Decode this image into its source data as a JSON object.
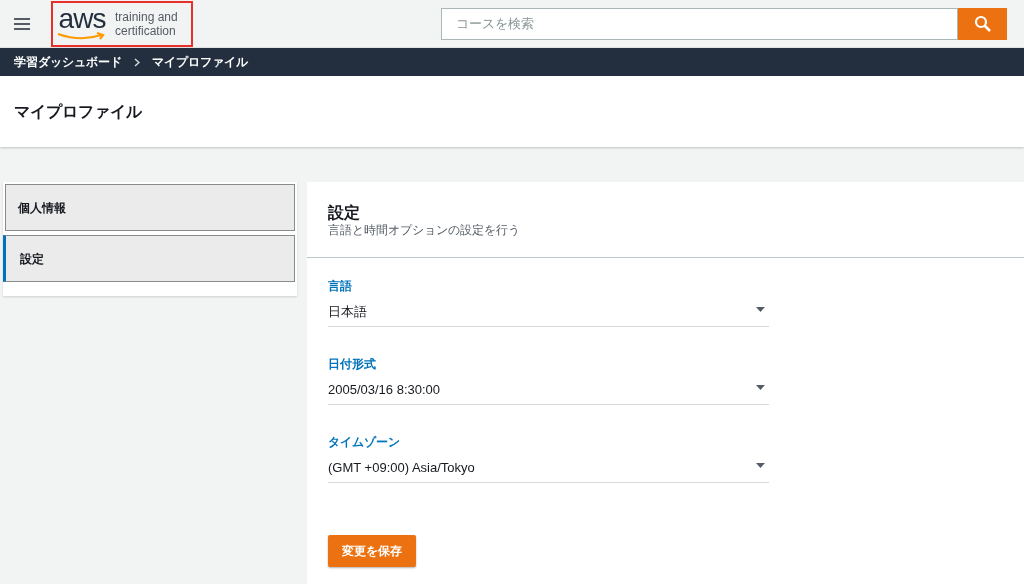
{
  "header": {
    "logo": {
      "mark": "aws",
      "line_1": "training and",
      "line_2": "certification",
      "highlighted": true
    },
    "search": {
      "placeholder": "コースを検索"
    }
  },
  "breadcrumb": [
    "学習ダッシュボード",
    "マイプロファイル"
  ],
  "page_title": "マイプロファイル",
  "sidebar": {
    "items": [
      {
        "label": "個人情報",
        "selected": false
      },
      {
        "label": "設定",
        "selected": true
      }
    ]
  },
  "settings": {
    "title": "設定",
    "subtitle": "言語と時間オプションの設定を行う",
    "fields": [
      {
        "label": "言語",
        "value": "日本語"
      },
      {
        "label": "日付形式",
        "value": "2005/03/16 8:30:00"
      },
      {
        "label": "タイムゾーン",
        "value": "(GMT +09:00) Asia/Tokyo"
      }
    ],
    "save_button": "変更を保存"
  }
}
